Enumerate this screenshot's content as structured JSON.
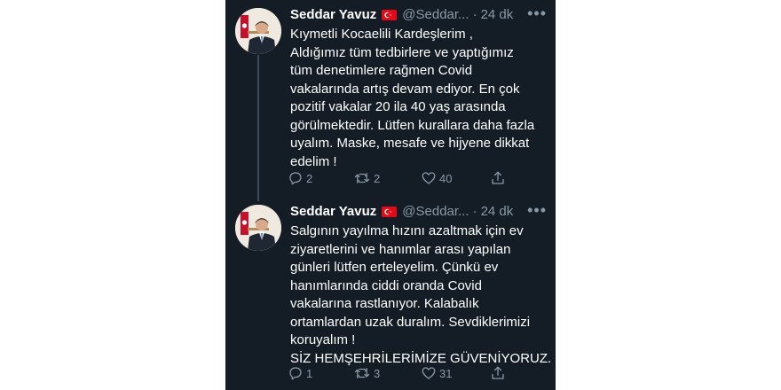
{
  "tweets": [
    {
      "author": "Seddar Yavuz",
      "flag_icon": "turkey-flag-icon",
      "handle": "@Seddar...",
      "separator": "·",
      "time": "24 dk",
      "more": "•••",
      "lines": [
        "Kıymetli Kocaelili Kardeşlerim ,",
        "Aldığımız tüm tedbirlere ve yaptığımız",
        "tüm denetimlere rağmen Covid",
        "vakalarında artış devam ediyor. En çok",
        "pozitif vakalar 20 ila 40 yaş arasında",
        "görülmektedir. Lütfen kurallara daha fazla",
        "uyalım. Maske, mesafe ve hijyene dikkat",
        "edelim !"
      ],
      "replies": "2",
      "retweets": "2",
      "likes": "40"
    },
    {
      "author": "Seddar Yavuz",
      "flag_icon": "turkey-flag-icon",
      "handle": "@Seddar...",
      "separator": "·",
      "time": "24 dk",
      "more": "•••",
      "lines": [
        "Salgının yayılma hızını azaltmak için ev",
        "ziyaretlerini ve hanımlar arası yapılan",
        "günleri lütfen erteleyelim. Çünkü ev",
        "hanımlarında ciddi oranda Covid",
        "vakalarına rastlanıyor. Kalabalık",
        "ortamlardan uzak duralım. Sevdiklerimizi",
        "koruyalım !",
        "SİZ HEMŞEHRİLERİMİZE GÜVENİYORUZ."
      ],
      "replies": "1",
      "retweets": "3",
      "likes": "31"
    }
  ],
  "colors": {
    "background": "#141d26",
    "text": "#ffffff",
    "muted": "#8899a6",
    "thread_line": "#3d4a56"
  }
}
